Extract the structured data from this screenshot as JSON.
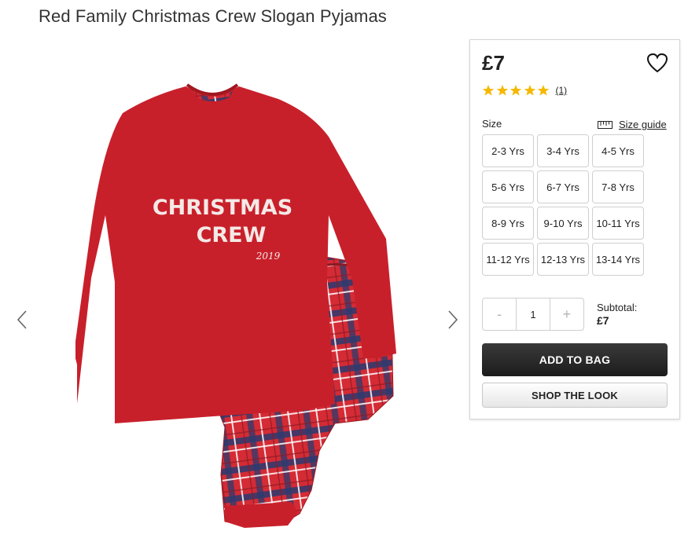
{
  "product": {
    "title": "Red Family Christmas Crew Slogan Pyjamas",
    "image": {
      "top_print_line1": "CHRISTMAS",
      "top_print_line2": "CREW",
      "top_print_year": "2019"
    }
  },
  "purchase": {
    "price": "£7",
    "rating": {
      "stars": 5,
      "review_count": "(1)"
    },
    "size_label": "Size",
    "size_guide_label": "Size guide",
    "sizes": [
      "2-3 Yrs",
      "3-4 Yrs",
      "4-5 Yrs",
      "5-6 Yrs",
      "6-7 Yrs",
      "7-8 Yrs",
      "8-9 Yrs",
      "9-10 Yrs",
      "10-11 Yrs",
      "11-12 Yrs",
      "12-13 Yrs",
      "13-14 Yrs"
    ],
    "quantity": {
      "decrement": "-",
      "value": "1",
      "increment": "+"
    },
    "subtotal_label": "Subtotal:",
    "subtotal_value": "£7",
    "add_to_bag": "ADD TO BAG",
    "shop_the_look": "SHOP THE LOOK"
  },
  "icons": {
    "prev": "chevron-left-icon",
    "next": "chevron-right-icon",
    "wishlist": "heart-icon",
    "rating": "star-icon",
    "size_guide": "ruler-icon"
  },
  "colors": {
    "star": "#f5b800",
    "top_red": "#c8202b",
    "button_dark": "#222222"
  }
}
